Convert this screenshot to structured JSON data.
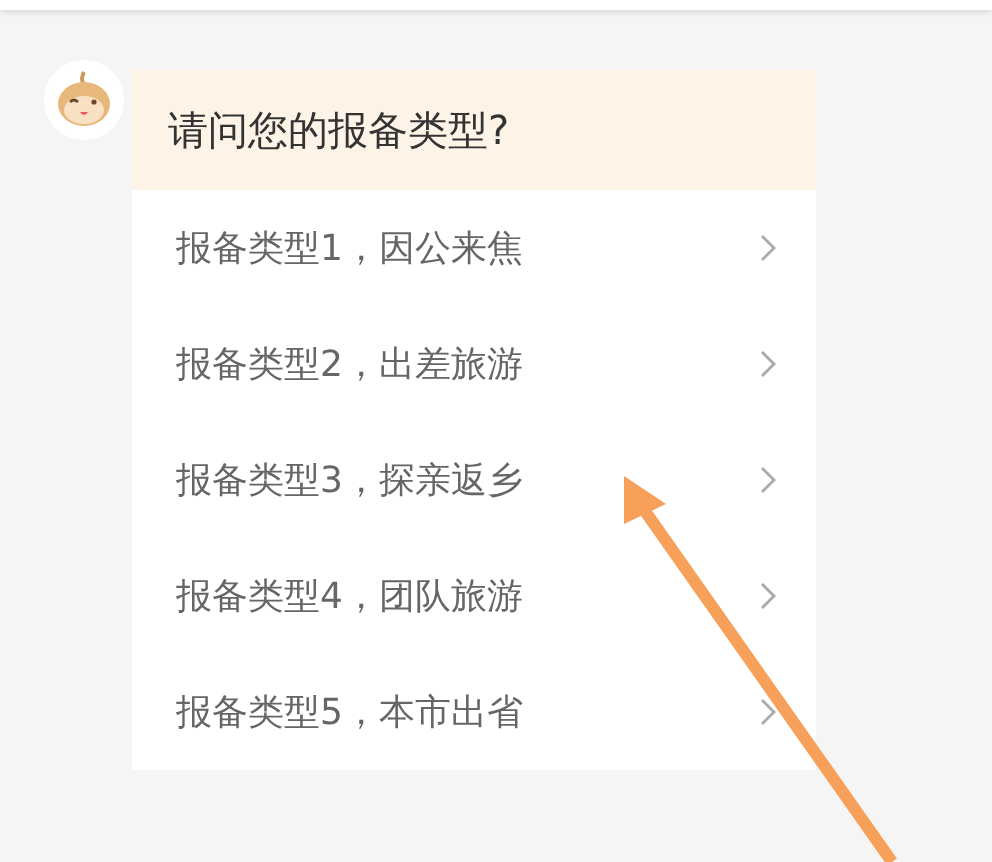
{
  "question": "请问您的报备类型?",
  "options": [
    {
      "label": "报备类型1，因公来焦"
    },
    {
      "label": "报备类型2，出差旅游"
    },
    {
      "label": "报备类型3，探亲返乡"
    },
    {
      "label": "报备类型4，团队旅游"
    },
    {
      "label": "报备类型5，本市出省"
    }
  ]
}
